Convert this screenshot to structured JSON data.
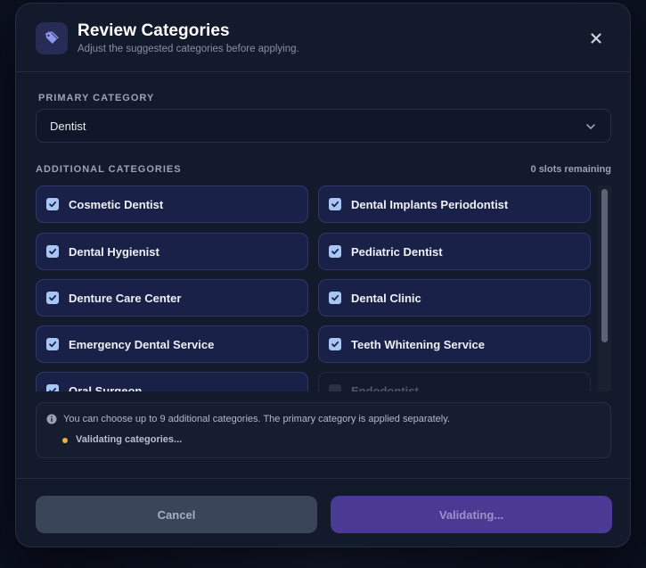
{
  "modal": {
    "title": "Review Categories",
    "subtitle": "Adjust the suggested categories before applying.",
    "close_label": "×"
  },
  "primary": {
    "label": "PRIMARY CATEGORY",
    "value": "Dentist"
  },
  "additional": {
    "label": "ADDITIONAL CATEGORIES",
    "slots": "0 slots remaining",
    "items": [
      {
        "label": "Cosmetic Dentist",
        "checked": true
      },
      {
        "label": "Dental Implants Periodontist",
        "checked": true
      },
      {
        "label": "Dental Hygienist",
        "checked": true
      },
      {
        "label": "Pediatric Dentist",
        "checked": true
      },
      {
        "label": "Denture Care Center",
        "checked": true
      },
      {
        "label": "Dental Clinic",
        "checked": true
      },
      {
        "label": "Emergency Dental Service",
        "checked": true
      },
      {
        "label": "Teeth Whitening Service",
        "checked": true
      },
      {
        "label": "Oral Surgeon",
        "checked": true
      },
      {
        "label": "Endodontist",
        "checked": false
      }
    ]
  },
  "info": {
    "text": "You can choose up to 9 additional categories. The primary category is applied separately.",
    "status": "Validating categories..."
  },
  "footer": {
    "cancel_label": "Cancel",
    "primary_label": "Validating..."
  },
  "colors": {
    "accent": "#4a3a94",
    "checkbox": "#a8c6f4",
    "status_dot": "#e7b33b"
  }
}
